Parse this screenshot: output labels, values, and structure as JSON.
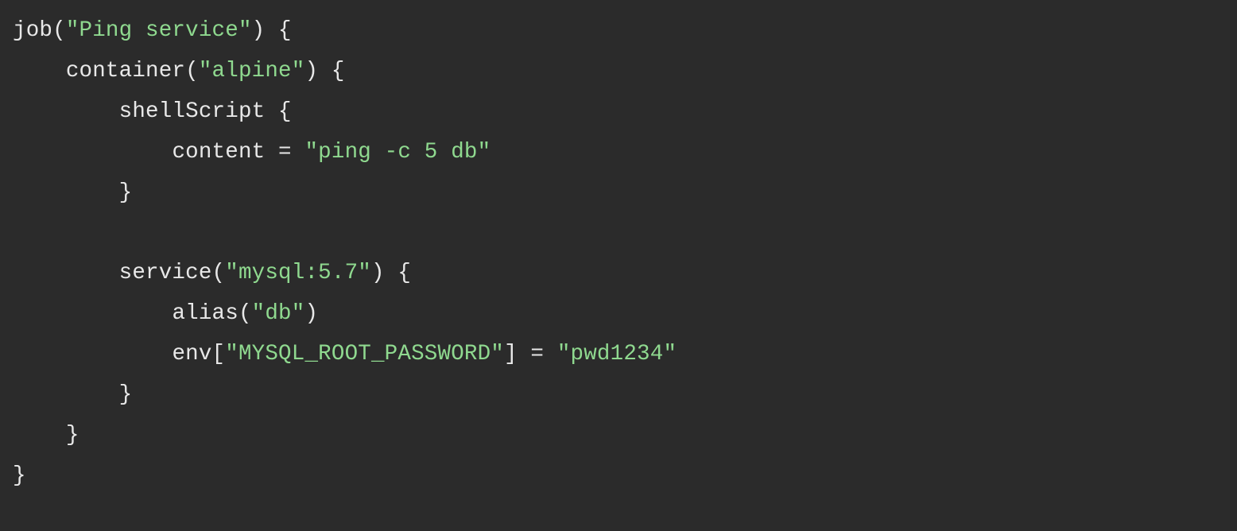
{
  "code": {
    "indent1": "    ",
    "indent2": "        ",
    "indent3": "            ",
    "line1": {
      "kw_job": "job",
      "open_paren": "(",
      "str": "\"Ping service\"",
      "close_paren_brace": ") {"
    },
    "line2": {
      "kw_container": "container",
      "open_paren": "(",
      "str": "\"alpine\"",
      "close_paren_brace": ") {"
    },
    "line3": {
      "kw_shellScript": "shellScript {"
    },
    "line4": {
      "kw_content_eq": "content = ",
      "str": "\"ping -c 5 db\""
    },
    "line5": {
      "close": "}"
    },
    "line6": {
      "blank": ""
    },
    "line7": {
      "kw_service": "service",
      "open_paren": "(",
      "str": "\"mysql:5.7\"",
      "close_paren_brace": ") {"
    },
    "line8": {
      "kw_alias": "alias",
      "open_paren": "(",
      "str": "\"db\"",
      "close_paren": ")"
    },
    "line9": {
      "kw_env_open": "env[",
      "str_key": "\"MYSQL_ROOT_PASSWORD\"",
      "close_eq": "] = ",
      "str_val": "\"pwd1234\""
    },
    "line10": {
      "close": "}"
    },
    "line11": {
      "close": "}"
    },
    "line12": {
      "close": "}"
    }
  }
}
